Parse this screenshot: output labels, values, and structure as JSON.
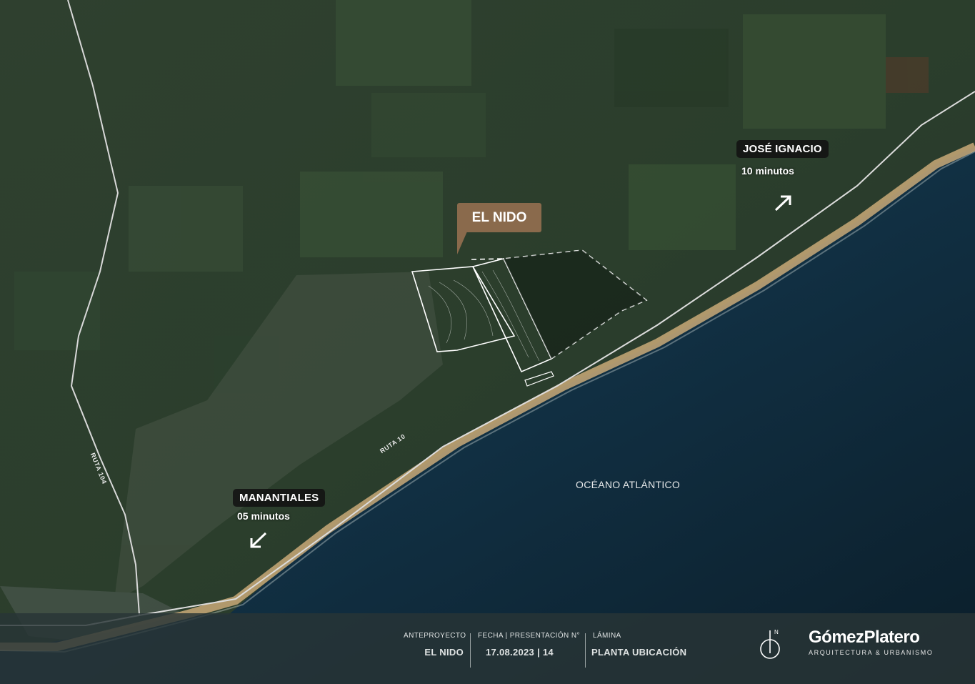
{
  "map": {
    "places": {
      "manantiales": {
        "name": "MANANTIALES",
        "time": "05 minutos"
      },
      "jose_ignacio": {
        "name": "JOSÉ IGNACIO",
        "time": "10 minutos"
      },
      "el_nido": {
        "name": "EL NIDO"
      }
    },
    "ocean_label": "OCÉANO ATLÁNTICO",
    "roads": {
      "ruta10": "RUTA 10",
      "ruta104": "RUTA 104"
    },
    "colors": {
      "land": "#2a3b2c",
      "sea": "#0d2a38",
      "beach": "#c9a978",
      "tag": "#8a6a4c"
    }
  },
  "footer": {
    "project": {
      "caption": "ANTEPROYECTO",
      "value": "EL NIDO"
    },
    "date": {
      "caption": "FECHA | PRESENTACIÓN N°",
      "value": "17.08.2023 | 14"
    },
    "sheet": {
      "caption": "LÁMINA",
      "value": "PLANTA UBICACIÓN"
    },
    "north_label": "N",
    "brand": {
      "name": "GómezPlatero",
      "tagline": "ARQUITECTURA & URBANISMO"
    }
  }
}
